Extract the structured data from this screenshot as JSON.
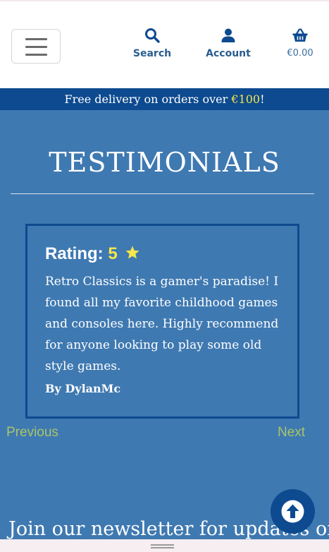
{
  "header": {
    "nav": {
      "search_label": "Search",
      "account_label": "Account",
      "basket_total": "€0.00"
    }
  },
  "promo": {
    "prefix": "Free delivery on orders over ",
    "amount": "€100",
    "suffix": "!"
  },
  "testimonials": {
    "title": "TESTIMONIALS",
    "card": {
      "rating_label": "Rating:",
      "rating_value": "5",
      "quote": "Retro Classics is a gamer's paradise! I found all my favorite childhood games and consoles here. Highly recommend for anyone looking to play some old style games.",
      "author": "By DylanMc"
    },
    "pager": {
      "previous_label": "Previous",
      "next_label": "Next"
    }
  },
  "newsletter": {
    "heading": "Join our newsletter for updates on"
  },
  "icons": {
    "menu": "hamburger-menu-icon",
    "search": "search-icon",
    "account": "user-icon",
    "basket": "shopping-basket-icon",
    "rating": "star-icon",
    "back_to_top": "arrow-up-icon"
  },
  "colors": {
    "brand_dark": "#0d4a8f",
    "section_bg": "#3f79b1",
    "accent_yellow": "#f5e64a",
    "pager_green": "#a9c56a",
    "nav_blue": "#2a5d8f"
  }
}
